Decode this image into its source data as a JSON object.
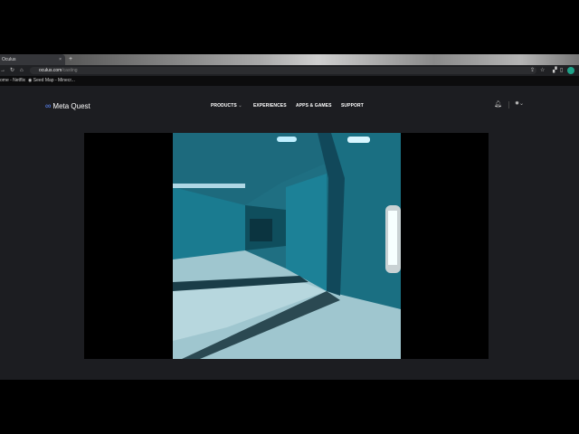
{
  "browser": {
    "tab_title": "Oculus",
    "tab_close": "×",
    "new_tab": "+",
    "url_host": "oculus.com",
    "url_path": "/casting",
    "bookmarks": [
      "ome - Netflix",
      "Seed Map - Minecr..."
    ]
  },
  "site": {
    "logo_text": "Meta Quest",
    "nav": [
      "PRODUCTS",
      "EXPERIENCES",
      "APPS & GAMES",
      "SUPPORT"
    ],
    "products_chevron": "⌄"
  }
}
